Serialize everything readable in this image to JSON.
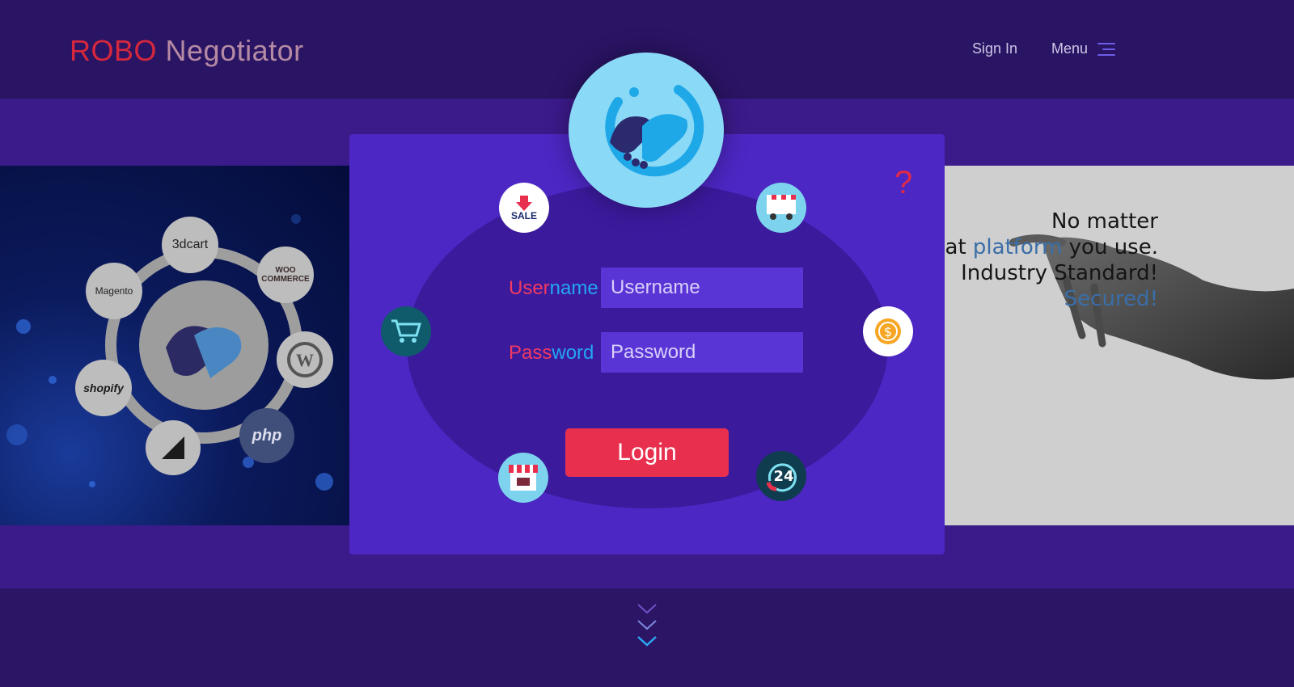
{
  "brand": {
    "part1": "ROBO",
    "part2": "Negotiator"
  },
  "nav": {
    "signin": "Sign In",
    "menu": "Menu"
  },
  "login": {
    "username_label_a": "User",
    "username_label_b": "name",
    "username_placeholder": "Username",
    "password_label_a": "Pass",
    "password_label_b": "word",
    "password_placeholder": "Password",
    "button": "Login",
    "help": "?"
  },
  "badges": {
    "sale_text": "SALE",
    "support_text": "24"
  },
  "platforms": [
    "3dcart",
    "WOO COMMERCE",
    "Magento",
    "shopify",
    "php"
  ],
  "tagline": {
    "line1": "No matter",
    "line2_pre": "what ",
    "line2_accent": "platform",
    "line2_post": " you use.",
    "line3": "Industry Standard!",
    "line4": "Secured!"
  },
  "colors": {
    "brand_red": "#d5283d",
    "card_purple": "#4c27c3",
    "login_red": "#e8304e",
    "accent_blue": "#24a7f2"
  }
}
